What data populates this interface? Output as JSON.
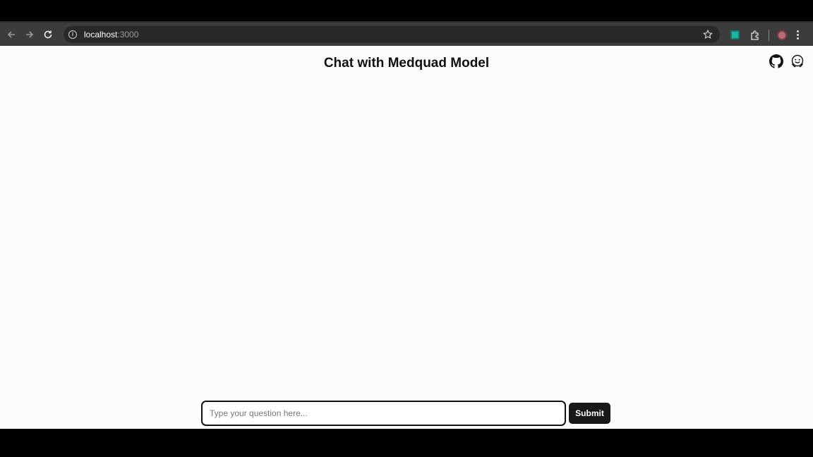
{
  "browser": {
    "url_host": "localhost",
    "url_port": ":3000",
    "colors": {
      "toolbar": "#3c3c3c",
      "omnibox": "#282828",
      "extension": "#1fb5a3"
    }
  },
  "page": {
    "title": "Chat with Medquad Model",
    "icons": [
      "github-icon",
      "huggingface-icon"
    ]
  },
  "chat": {
    "input_placeholder": "Type your question here...",
    "input_value": "",
    "submit_label": "Submit"
  }
}
